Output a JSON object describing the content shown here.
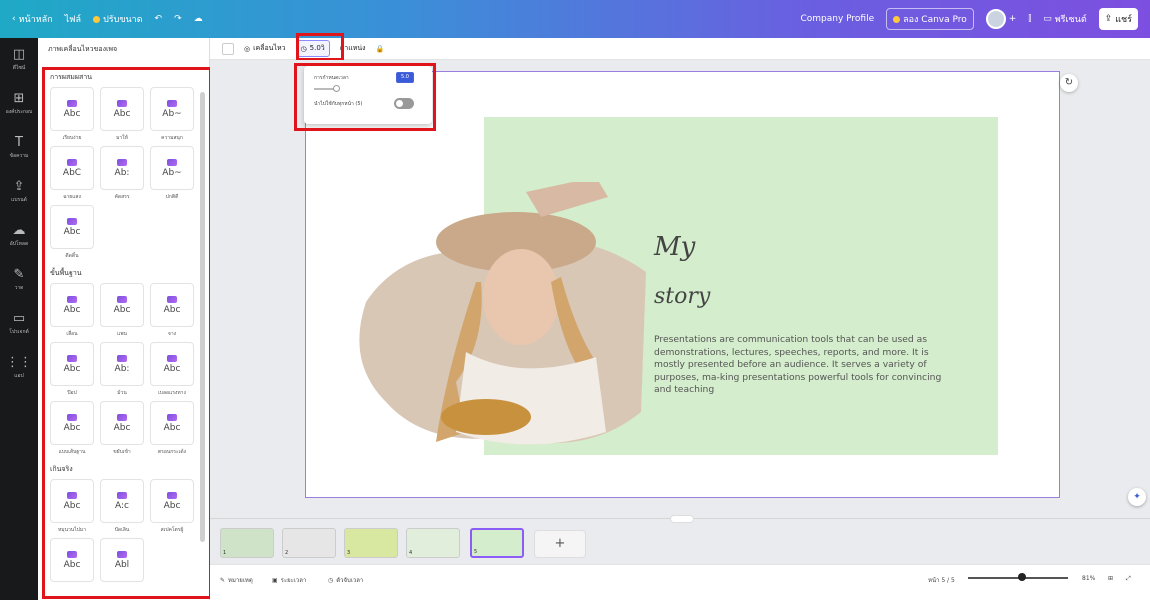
{
  "topbar": {
    "home": "หน้าหลัก",
    "file": "ไฟล์",
    "resize": "ปรับขนาด",
    "undo": "↶",
    "redo": "↷",
    "cloud": "☁",
    "doc_title": "Company Profile",
    "try_pro": "ลอง Canva Pro",
    "plus": "+",
    "present": "พรีเซนต์",
    "share": "แชร์"
  },
  "rail": [
    {
      "icon": "◫",
      "label": "ดีไซน์"
    },
    {
      "icon": "⊞",
      "label": "องค์ประกอบ"
    },
    {
      "icon": "T",
      "label": "ข้อความ"
    },
    {
      "icon": "⇪",
      "label": "แบรนด์"
    },
    {
      "icon": "☁",
      "label": "อัปโหลด"
    },
    {
      "icon": "✎",
      "label": "วาด"
    },
    {
      "icon": "▭",
      "label": "โปรเจกต์"
    },
    {
      "icon": "⋮⋮",
      "label": "แอป"
    }
  ],
  "panel": {
    "title": "ภาพเคลื่อนไหวของเพจ",
    "sections": [
      {
        "title": "การผสมผสาน",
        "items": [
          {
            "glyph": "Abc",
            "caption": "เรียบง่าย"
          },
          {
            "glyph": "Abc",
            "caption": "มาให้"
          },
          {
            "glyph": "Ab~",
            "caption": "ความสนุก"
          },
          {
            "glyph": "AbC",
            "caption": "ฉายแสง"
          },
          {
            "glyph": "Ab:",
            "caption": "คัดสรร"
          },
          {
            "glyph": "Ab~",
            "caption": "ปกติดี"
          },
          {
            "glyph": "Abc",
            "caption": "ดีดดิ้น"
          }
        ]
      },
      {
        "title": "ขั้นพื้นฐาน",
        "items": [
          {
            "glyph": "Abc",
            "caption": "เลื่อน"
          },
          {
            "glyph": "Abc",
            "caption": "แพน"
          },
          {
            "glyph": "Abc",
            "caption": "จาง"
          },
          {
            "glyph": "Abc",
            "caption": "ป๊อป"
          },
          {
            "glyph": "Ab:",
            "caption": "ม้วน"
          },
          {
            "glyph": "Abc",
            "caption": "เบลอแรงทาง"
          },
          {
            "glyph": "Abc",
            "caption": "แบบเส้นฐาน"
          },
          {
            "glyph": "Abc",
            "caption": "ขยับเข้า"
          },
          {
            "glyph": "Abc",
            "caption": "ตรอนกระเด้ง"
          }
        ]
      },
      {
        "title": "เกินจริง",
        "items": [
          {
            "glyph": "Abc",
            "caption": "หมุนวนไปมา"
          },
          {
            "glyph": "A:c",
            "caption": "ปัดเลิน"
          },
          {
            "glyph": "Abc",
            "caption": "สเปคโตรผู้"
          },
          {
            "glyph": "Abc",
            "caption": ""
          },
          {
            "glyph": "Abl",
            "caption": ""
          }
        ]
      }
    ]
  },
  "toolbar": {
    "animate": "เคลื่อนไหว",
    "duration": "5.0วิ",
    "position": "ตำแหน่ง",
    "lock": "🔒"
  },
  "popup": {
    "duration_label": "การกำหนดเวลา",
    "duration_value": "5.0",
    "apply_all_label": "นำไปใช้กับทุกหน้า (5)",
    "apply_all_on": false
  },
  "slide": {
    "title_line1": "My",
    "title_line2": "story",
    "body": "Presentations are communication tools that can be used as demonstrations, lectures, speeches, reports, and more. It is mostly presented before an audience. It serves a variety of purposes, ma-king presentations powerful tools for convincing and teaching"
  },
  "filmstrip": {
    "thumbs": [
      {
        "num": "1",
        "bg": "#cfe3c8"
      },
      {
        "num": "2",
        "bg": "#e6e6e6"
      },
      {
        "num": "3",
        "bg": "#d8e8a0"
      },
      {
        "num": "4",
        "bg": "#e0eedb"
      },
      {
        "num": "5",
        "bg": "#d4edcc"
      }
    ],
    "add": "+"
  },
  "status": {
    "notes": "หมายเหตุ",
    "timer": "ระยะเวลา",
    "timeline": "ตัวจับเวลา",
    "page": "หน้า 5 / 5",
    "zoom": "81%",
    "zoom_value_percent": 81
  },
  "colors": {
    "accent": "#7d4fe0",
    "highlight_box": "#e0141b",
    "green_panel": "#d4edcc"
  }
}
